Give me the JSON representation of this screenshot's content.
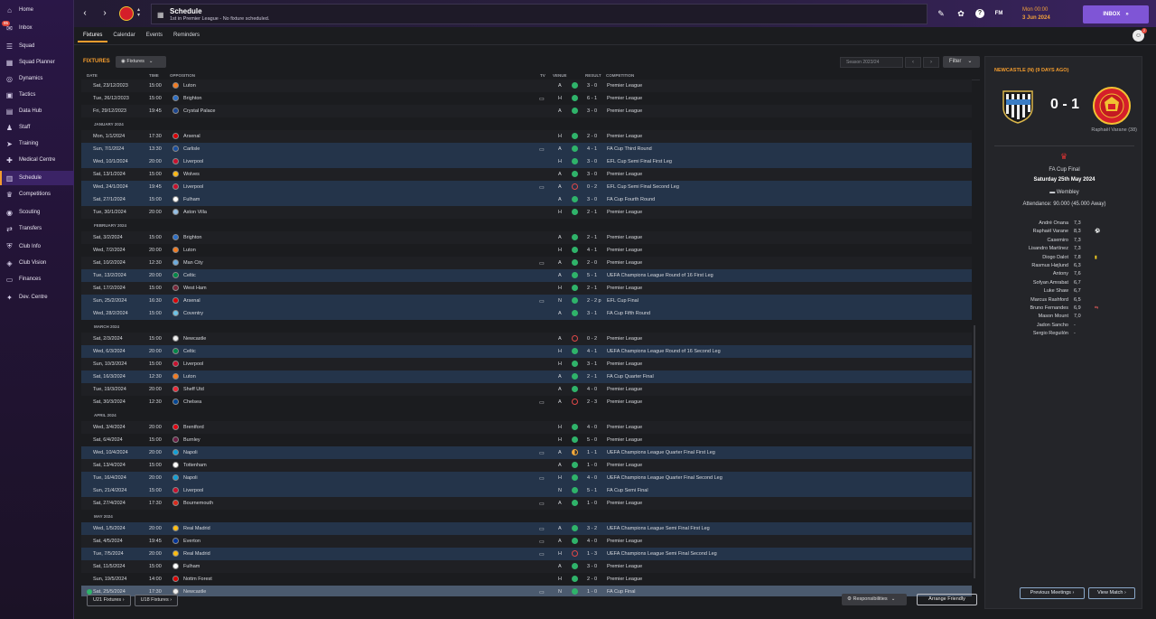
{
  "sidebar": {
    "items": [
      {
        "label": "Home",
        "icon": "home-icon",
        "glyph": "⌂"
      },
      {
        "label": "Inbox",
        "icon": "inbox-icon",
        "glyph": "✉",
        "badge": "95"
      },
      {
        "label": "Squad",
        "icon": "squad-icon",
        "glyph": "☰"
      },
      {
        "label": "Squad Planner",
        "icon": "squad-planner-icon",
        "glyph": "▦"
      },
      {
        "label": "Dynamics",
        "icon": "dynamics-icon",
        "glyph": "◎"
      },
      {
        "label": "Tactics",
        "icon": "tactics-icon",
        "glyph": "▣"
      },
      {
        "label": "Data Hub",
        "icon": "data-hub-icon",
        "glyph": "▤"
      },
      {
        "label": "Staff",
        "icon": "staff-icon",
        "glyph": "♟"
      },
      {
        "label": "Training",
        "icon": "training-icon",
        "glyph": "➤"
      },
      {
        "label": "Medical Centre",
        "icon": "medical-icon",
        "glyph": "✚"
      },
      {
        "label": "Schedule",
        "icon": "schedule-icon",
        "glyph": "▥",
        "active": true
      },
      {
        "label": "Competitions",
        "icon": "trophy-icon",
        "glyph": "♛"
      },
      {
        "label": "Scouting",
        "icon": "scouting-icon",
        "glyph": "◉"
      },
      {
        "label": "Transfers",
        "icon": "transfers-icon",
        "glyph": "⇄"
      },
      {
        "label": "Club Info",
        "icon": "club-info-icon",
        "glyph": "⛨"
      },
      {
        "label": "Club Vision",
        "icon": "club-vision-icon",
        "glyph": "◈"
      },
      {
        "label": "Finances",
        "icon": "finances-icon",
        "glyph": "▭"
      },
      {
        "label": "Dev. Centre",
        "icon": "dev-centre-icon",
        "glyph": "✦"
      }
    ]
  },
  "header": {
    "title": "Schedule",
    "subtitle": "1st in Premier League - No fixture scheduled.",
    "time": "Mon 00:00",
    "date": "3 Jun 2024",
    "inbox_label": "INBOX",
    "fm_label": "FM",
    "notif_count": "2"
  },
  "tabs": [
    "Fixtures",
    "Calendar",
    "Events",
    "Reminders"
  ],
  "main": {
    "section_title": "FIXTURES",
    "dropdown_label": "Fixtures",
    "season": "Season 2023/24",
    "filter_label": "Filter",
    "columns": {
      "date": "DATE",
      "time": "TIME",
      "opposition": "OPPOSITION",
      "tv": "TV",
      "venue": "VENUE",
      "result": "RESULT",
      "competition": "COMPETITION"
    },
    "u21_label": "U21 Fixtures",
    "u18_label": "U18 Fixtures",
    "responsibilities_label": "Responsibilities",
    "friendly_label": "Arrange Friendly"
  },
  "fixtures": [
    {
      "date": "Sat, 23/12/2023",
      "time": "15:00",
      "opp": "Luton",
      "crest": "#f47b20",
      "tv": false,
      "venue": "A",
      "dot": "w",
      "res": "3 - 0",
      "comp": "Premier League",
      "bg": "alt"
    },
    {
      "date": "Tue, 26/12/2023",
      "time": "15:00",
      "opp": "Brighton",
      "crest": "#2d6fc7",
      "tv": true,
      "venue": "H",
      "dot": "w",
      "res": "6 - 1",
      "comp": "Premier League",
      "bg": ""
    },
    {
      "date": "Fri, 29/12/2023",
      "time": "19:45",
      "opp": "Crystal Palace",
      "crest": "#1b458f",
      "tv": false,
      "venue": "A",
      "dot": "w",
      "res": "3 - 0",
      "comp": "Premier League",
      "bg": "alt"
    },
    {
      "month": "JANUARY 2024"
    },
    {
      "date": "Mon, 1/1/2024",
      "time": "17:30",
      "opp": "Arsenal",
      "crest": "#db0007",
      "tv": false,
      "venue": "H",
      "dot": "w",
      "res": "2 - 0",
      "comp": "Premier League",
      "bg": "alt"
    },
    {
      "date": "Sun, 7/1/2024",
      "time": "13:30",
      "opp": "Carlisle",
      "crest": "#1a4fa0",
      "tv": true,
      "venue": "A",
      "dot": "w",
      "res": "4 - 1",
      "comp": "FA Cup Third Round",
      "bg": "blue"
    },
    {
      "date": "Wed, 10/1/2024",
      "time": "20:00",
      "opp": "Liverpool",
      "crest": "#c8102e",
      "tv": false,
      "venue": "H",
      "dot": "w",
      "res": "3 - 0",
      "comp": "EFL Cup Semi Final First Leg",
      "bg": "blue"
    },
    {
      "date": "Sat, 13/1/2024",
      "time": "15:00",
      "opp": "Wolves",
      "crest": "#fdb913",
      "tv": false,
      "venue": "A",
      "dot": "w",
      "res": "3 - 0",
      "comp": "Premier League",
      "bg": "alt"
    },
    {
      "date": "Wed, 24/1/2024",
      "time": "19:45",
      "opp": "Liverpool",
      "crest": "#c8102e",
      "tv": true,
      "venue": "A",
      "dot": "l",
      "res": "0 - 2",
      "comp": "EFL Cup Semi Final Second Leg",
      "bg": "blue"
    },
    {
      "date": "Sat, 27/1/2024",
      "time": "15:00",
      "opp": "Fulham",
      "crest": "#ffffff",
      "tv": false,
      "venue": "A",
      "dot": "w",
      "res": "3 - 0",
      "comp": "FA Cup Fourth Round",
      "bg": "blue"
    },
    {
      "date": "Tue, 30/1/2024",
      "time": "20:00",
      "opp": "Aston Villa",
      "crest": "#95bfe5",
      "tv": false,
      "venue": "H",
      "dot": "w",
      "res": "2 - 1",
      "comp": "Premier League",
      "bg": "alt"
    },
    {
      "month": "FEBRUARY 2024"
    },
    {
      "date": "Sat, 3/2/2024",
      "time": "15:00",
      "opp": "Brighton",
      "crest": "#2d6fc7",
      "tv": false,
      "venue": "A",
      "dot": "w",
      "res": "2 - 1",
      "comp": "Premier League",
      "bg": "alt"
    },
    {
      "date": "Wed, 7/2/2024",
      "time": "20:00",
      "opp": "Luton",
      "crest": "#f47b20",
      "tv": false,
      "venue": "H",
      "dot": "w",
      "res": "4 - 1",
      "comp": "Premier League",
      "bg": ""
    },
    {
      "date": "Sat, 10/2/2024",
      "time": "12:30",
      "opp": "Man City",
      "crest": "#6cabdd",
      "tv": true,
      "venue": "A",
      "dot": "w",
      "res": "2 - 0",
      "comp": "Premier League",
      "bg": "alt"
    },
    {
      "date": "Tue, 13/2/2024",
      "time": "20:00",
      "opp": "Celtic",
      "crest": "#018749",
      "tv": false,
      "venue": "A",
      "dot": "w",
      "res": "5 - 1",
      "comp": "UEFA Champions League Round of 16 First Leg",
      "bg": "blue"
    },
    {
      "date": "Sat, 17/2/2024",
      "time": "15:00",
      "opp": "West Ham",
      "crest": "#7a263a",
      "tv": false,
      "venue": "H",
      "dot": "w",
      "res": "2 - 1",
      "comp": "Premier League",
      "bg": "alt"
    },
    {
      "date": "Sun, 25/2/2024",
      "time": "16:30",
      "opp": "Arsenal",
      "crest": "#db0007",
      "tv": true,
      "venue": "N",
      "dot": "w",
      "res": "2 - 2 p",
      "comp": "EFL Cup Final",
      "bg": "blue"
    },
    {
      "date": "Wed, 28/2/2024",
      "time": "15:00",
      "opp": "Coventry",
      "crest": "#6cc3e8",
      "tv": false,
      "venue": "A",
      "dot": "w",
      "res": "3 - 1",
      "comp": "FA Cup Fifth Round",
      "bg": "blue"
    },
    {
      "month": "MARCH 2024"
    },
    {
      "date": "Sat, 2/3/2024",
      "time": "15:00",
      "opp": "Newcastle",
      "crest": "#eeeeee",
      "tv": false,
      "venue": "A",
      "dot": "l",
      "res": "0 - 2",
      "comp": "Premier League",
      "bg": "alt"
    },
    {
      "date": "Wed, 6/3/2024",
      "time": "20:00",
      "opp": "Celtic",
      "crest": "#018749",
      "tv": false,
      "venue": "H",
      "dot": "w",
      "res": "4 - 1",
      "comp": "UEFA Champions League Round of 16 Second Leg",
      "bg": "blue"
    },
    {
      "date": "Sun, 10/3/2024",
      "time": "15:00",
      "opp": "Liverpool",
      "crest": "#c8102e",
      "tv": false,
      "venue": "H",
      "dot": "w",
      "res": "3 - 1",
      "comp": "Premier League",
      "bg": "alt"
    },
    {
      "date": "Sat, 16/3/2024",
      "time": "12:30",
      "opp": "Luton",
      "crest": "#f47b20",
      "tv": false,
      "venue": "A",
      "dot": "w",
      "res": "2 - 1",
      "comp": "FA Cup Quarter Final",
      "bg": "blue"
    },
    {
      "date": "Tue, 19/3/2024",
      "time": "20:00",
      "opp": "Sheff Utd",
      "crest": "#ee2737",
      "tv": false,
      "venue": "A",
      "dot": "w",
      "res": "4 - 0",
      "comp": "Premier League",
      "bg": "alt"
    },
    {
      "date": "Sat, 30/3/2024",
      "time": "12:30",
      "opp": "Chelsea",
      "crest": "#034694",
      "tv": true,
      "venue": "A",
      "dot": "l",
      "res": "2 - 3",
      "comp": "Premier League",
      "bg": ""
    },
    {
      "month": "APRIL 2024"
    },
    {
      "date": "Wed, 3/4/2024",
      "time": "20:00",
      "opp": "Brentford",
      "crest": "#e30613",
      "tv": false,
      "venue": "H",
      "dot": "w",
      "res": "4 - 0",
      "comp": "Premier League",
      "bg": "alt"
    },
    {
      "date": "Sat, 6/4/2024",
      "time": "15:00",
      "opp": "Burnley",
      "crest": "#6c1d45",
      "tv": false,
      "venue": "H",
      "dot": "w",
      "res": "5 - 0",
      "comp": "Premier League",
      "bg": ""
    },
    {
      "date": "Wed, 10/4/2024",
      "time": "20:00",
      "opp": "Napoli",
      "crest": "#12a0d7",
      "tv": true,
      "venue": "A",
      "dot": "d",
      "res": "1 - 1",
      "comp": "UEFA Champions League Quarter Final First Leg",
      "bg": "blue"
    },
    {
      "date": "Sat, 13/4/2024",
      "time": "15:00",
      "opp": "Tottenham",
      "crest": "#ffffff",
      "tv": false,
      "venue": "A",
      "dot": "w",
      "res": "1 - 0",
      "comp": "Premier League",
      "bg": "alt"
    },
    {
      "date": "Tue, 16/4/2024",
      "time": "20:00",
      "opp": "Napoli",
      "crest": "#12a0d7",
      "tv": true,
      "venue": "H",
      "dot": "w",
      "res": "4 - 0",
      "comp": "UEFA Champions League Quarter Final Second Leg",
      "bg": "blue"
    },
    {
      "date": "Sun, 21/4/2024",
      "time": "15:00",
      "opp": "Liverpool",
      "crest": "#c8102e",
      "tv": false,
      "venue": "N",
      "dot": "w",
      "res": "5 - 1",
      "comp": "FA Cup Semi Final",
      "bg": "blue"
    },
    {
      "date": "Sat, 27/4/2024",
      "time": "17:30",
      "opp": "Bournemouth",
      "crest": "#da291c",
      "tv": true,
      "venue": "A",
      "dot": "w",
      "res": "1 - 0",
      "comp": "Premier League",
      "bg": "alt"
    },
    {
      "month": "MAY 2024"
    },
    {
      "date": "Wed, 1/5/2024",
      "time": "20:00",
      "opp": "Real Madrid",
      "crest": "#febe10",
      "tv": true,
      "venue": "A",
      "dot": "w",
      "res": "3 - 2",
      "comp": "UEFA Champions League Semi Final First Leg",
      "bg": "blue"
    },
    {
      "date": "Sat, 4/5/2024",
      "time": "19:45",
      "opp": "Everton",
      "crest": "#003399",
      "tv": true,
      "venue": "A",
      "dot": "w",
      "res": "4 - 0",
      "comp": "Premier League",
      "bg": "alt"
    },
    {
      "date": "Tue, 7/5/2024",
      "time": "20:00",
      "opp": "Real Madrid",
      "crest": "#febe10",
      "tv": true,
      "venue": "H",
      "dot": "l",
      "res": "1 - 3",
      "comp": "UEFA Champions League Semi Final Second Leg",
      "bg": "blue"
    },
    {
      "date": "Sat, 11/5/2024",
      "time": "15:00",
      "opp": "Fulham",
      "crest": "#ffffff",
      "tv": false,
      "venue": "A",
      "dot": "w",
      "res": "3 - 0",
      "comp": "Premier League",
      "bg": "alt"
    },
    {
      "date": "Sun, 19/5/2024",
      "time": "14:00",
      "opp": "Nottm Forest",
      "crest": "#dd0000",
      "tv": false,
      "venue": "H",
      "dot": "w",
      "res": "2 - 0",
      "comp": "Premier League",
      "bg": ""
    },
    {
      "date": "Sat, 25/5/2024",
      "time": "17:30",
      "opp": "Newcastle",
      "crest": "#eeeeee",
      "tv": true,
      "venue": "N",
      "dot": "w",
      "res": "1 - 0",
      "comp": "FA Cup Final",
      "bg": "sel",
      "tick": true
    }
  ],
  "match_panel": {
    "title": "NEWCASTLE (N) (9 DAYS AGO)",
    "score": "0 - 1",
    "scorer": "Raphaël Varane (38)",
    "competition": "FA Cup Final",
    "date": "Saturday 25th May 2024",
    "venue": "Wembley",
    "attendance": "Attendance: 90.000 (45.000 Away)",
    "home_colors": [
      "#111111",
      "#eeeeee"
    ],
    "away_colors": [
      "#d51f2a",
      "#f1c232"
    ],
    "ratings": [
      {
        "name": "André Onana",
        "rating": "7,3",
        "icon": ""
      },
      {
        "name": "Raphaël Varane",
        "rating": "8,3",
        "icon": "⚽"
      },
      {
        "name": "Casemiro",
        "rating": "7,3",
        "icon": ""
      },
      {
        "name": "Lisandro Martínez",
        "rating": "7,3",
        "icon": ""
      },
      {
        "name": "Diogo Dalot",
        "rating": "7,8",
        "icon": "▮"
      },
      {
        "name": "Rasmus Højlund",
        "rating": "6,3",
        "icon": ""
      },
      {
        "name": "Antony",
        "rating": "7,6",
        "icon": ""
      },
      {
        "name": "Sofyan Amrabat",
        "rating": "6,7",
        "icon": ""
      },
      {
        "name": "Luke Shaw",
        "rating": "6,7",
        "icon": ""
      },
      {
        "name": "Marcus Rashford",
        "rating": "6,5",
        "icon": ""
      },
      {
        "name": "Bruno Fernandes",
        "rating": "6,9",
        "icon": "⇆"
      },
      {
        "name": "Mason Mount",
        "rating": "7,0",
        "icon": ""
      },
      {
        "name": "Jadon Sancho",
        "rating": "-",
        "icon": ""
      },
      {
        "name": "Sergio Reguilón",
        "rating": "-",
        "icon": ""
      }
    ],
    "prev_meetings_label": "Previous Meetings",
    "view_match_label": "View Match"
  }
}
